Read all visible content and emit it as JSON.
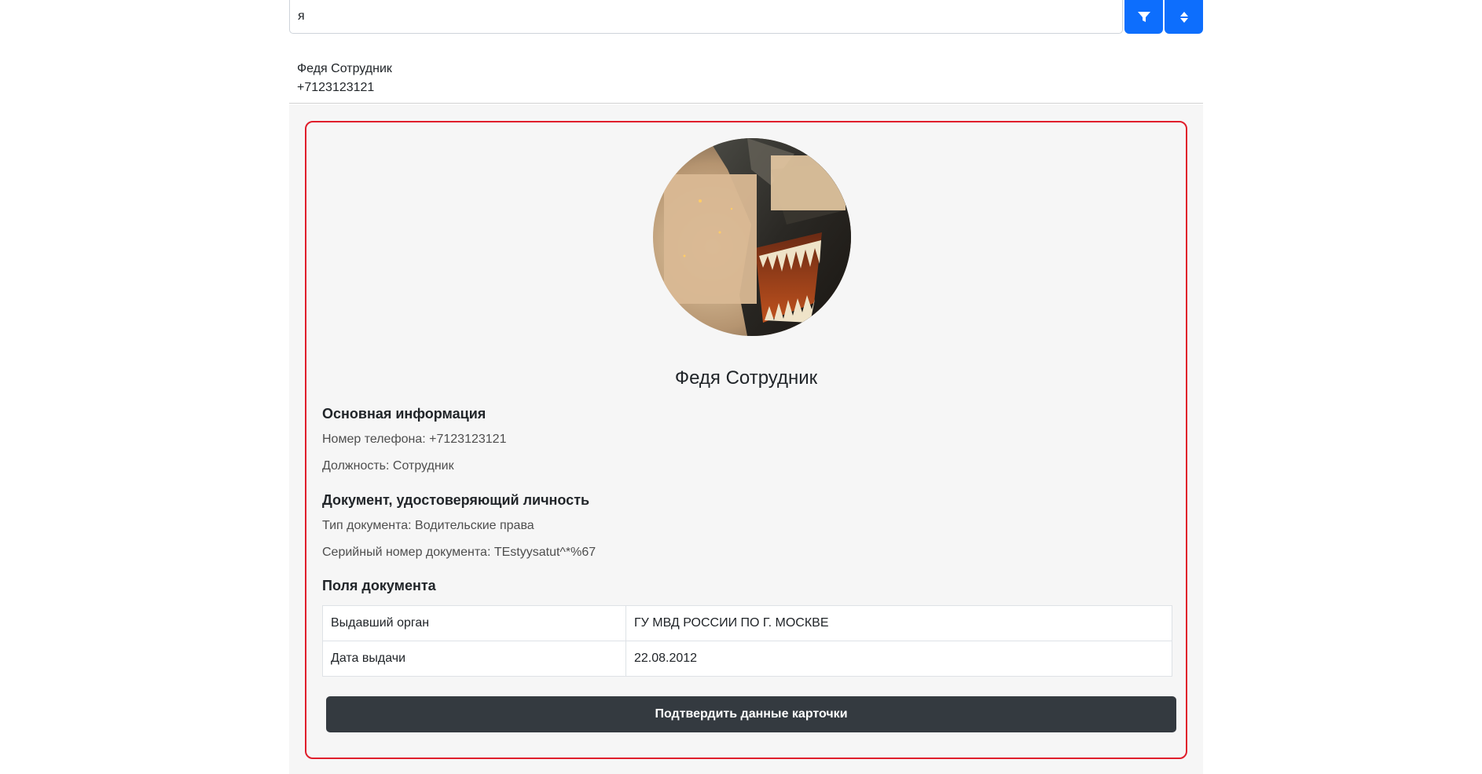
{
  "search": {
    "value": "я"
  },
  "toolbar": {
    "filter_icon": "filter-icon",
    "sort_icon": "sort-icon"
  },
  "results": [
    {
      "name": "Федя Сотрудник",
      "phone": "+7123123121"
    }
  ],
  "card": {
    "name": "Федя Сотрудник",
    "avatar_desc": "dinosaur-photo",
    "basic_info": {
      "title": "Основная информация",
      "phone": "Номер телефона: +7123123121",
      "position": "Должность: Сотрудник"
    },
    "identity_doc": {
      "title": "Документ, удостоверяющий личность",
      "type": "Тип документа: Водительские права",
      "serial": "Серийный номер документа: TEstyysatut^*%67"
    },
    "doc_fields": {
      "title": "Поля документа",
      "rows": [
        {
          "label": "Выдавший орган",
          "value": "ГУ МВД РОССИИ ПО Г. МОСКВЕ"
        },
        {
          "label": "Дата выдачи",
          "value": "22.08.2012"
        }
      ]
    },
    "confirm_label": "Подтвердить данные карточки"
  },
  "colors": {
    "primary": "#0d6efd",
    "card_border": "#e01e2b",
    "dark_button": "#343a40",
    "panel_bg": "#f6f6f6"
  }
}
